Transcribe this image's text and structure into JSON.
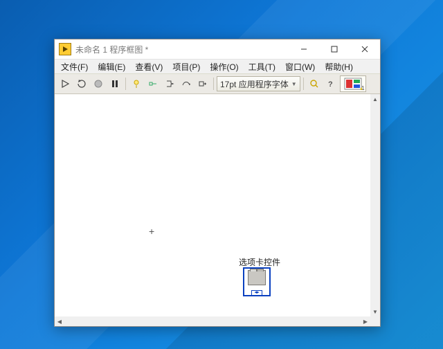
{
  "window": {
    "title": "未命名 1 程序框图 *"
  },
  "menu": {
    "file": "文件(F)",
    "edit": "编辑(E)",
    "view": "查看(V)",
    "project": "项目(P)",
    "operate": "操作(O)",
    "tools": "工具(T)",
    "window": "窗口(W)",
    "help": "帮助(H)"
  },
  "toolbar": {
    "font_label": "17pt 应用程序字体",
    "ctx_index": "1"
  },
  "canvas": {
    "node_label": "选项卡控件"
  }
}
